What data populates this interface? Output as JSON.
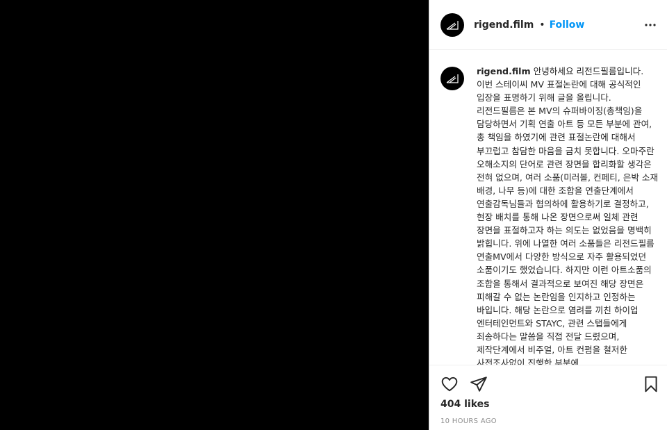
{
  "post": {
    "username": "rigend.film",
    "separator": "•",
    "follow_label": "Follow",
    "more_icon": "more-options-icon"
  },
  "caption": {
    "username": "rigend.film",
    "text": "안녕하세요 리전드필름입니다. 이번 스테이씨 MV 표절논란에 대해 공식적인 입장을 표명하기 위해 글을 올립니다. 리전드필름은 본 MV의 슈퍼바이징(총책임)을 담당하면서 기획 연출 아트 등 모든 부분에 관여, 총 책임을 하였기에 관련 표절논란에 대해서 부끄럽고 참담한 마음을 금치 못합니다. 오마주란 오해소지의 단어로 관련 장면을 합리화할 생각은 전혀 없으며, 여러 소품(미러볼, 컨페티, 은박 소재 배경, 나무 등)에 대한 조합을 연출단계에서 연출감독님들과 협의하에 활용하기로 결정하고, 현장 배치를 통해 나온 장면으로써 일체 관련 장면을 표절하고자 하는 의도는 없었음을 명백히 밝힙니다. 위에 나열한 여러 소품들은 리전드필름 연출MV에서 다양한 방식으로 자주 활용되었던 소품이기도 했었습니다. 하지만 이런 아트소품의 조합을 통해서 결과적으로 보여진 해당 장면은 피해갈 수 없는 논란임을 인지하고 인정하는 바입니다. 해당 논란으로 염려를 끼친 하이업 엔터테인먼트와 STAYC, 관련 스탭들에게 죄송하다는 말씀을 직접 전달 드렸으며, 제작단계에서 비주얼, 아트 컨펌을 철저한 사전조사없이 진행한 부분에"
  },
  "actions": {
    "heart_icon": "heart-icon",
    "share_icon": "paper-plane-icon",
    "save_icon": "bookmark-icon"
  },
  "likes": "404 likes",
  "timestamp": "10 HOURS AGO",
  "colors": {
    "follow": "#0095f6",
    "text": "#262626",
    "muted": "#8e8e8e",
    "media_bg": "#000000"
  }
}
